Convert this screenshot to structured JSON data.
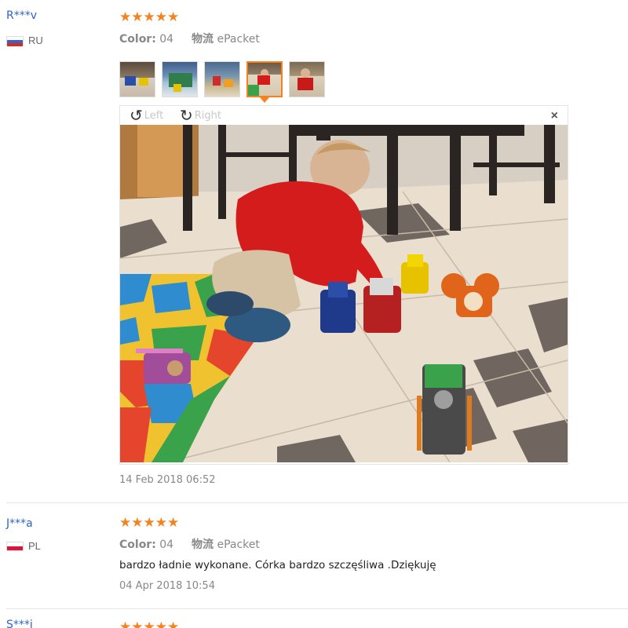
{
  "reviews": [
    {
      "user": "R***v",
      "country": "RU",
      "flag_colors": [
        "#ffffff",
        "#3a5fcd",
        "#d52b1e"
      ],
      "stars": "★★★★★",
      "color_label": "Color:",
      "color_value": "04",
      "logistics_label": "物流",
      "logistics_value": "ePacket",
      "viewer": {
        "rotate_left_icon": "rotate-left-icon",
        "rotate_left": "Left",
        "rotate_right_icon": "rotate-right-icon",
        "rotate_right": "Right",
        "close": "×",
        "active_thumb_index": 3,
        "thumb_count": 5
      },
      "date": "14 Feb 2018 06:52"
    },
    {
      "user": "J***a",
      "country": "PL",
      "flag_colors": [
        "#ffffff",
        "#dc143c"
      ],
      "stars": "★★★★★",
      "color_label": "Color:",
      "color_value": "04",
      "logistics_label": "物流",
      "logistics_value": "ePacket",
      "text": "bardzo ładnie wykonane. Córka bardzo szczęśliwa .Dziękuję",
      "date": "04 Apr 2018 10:54"
    },
    {
      "user": "S***i",
      "stars": "★★★★★"
    }
  ],
  "colors": {
    "star": "#f5821f",
    "username": "#2e64c7",
    "muted": "#888888"
  }
}
